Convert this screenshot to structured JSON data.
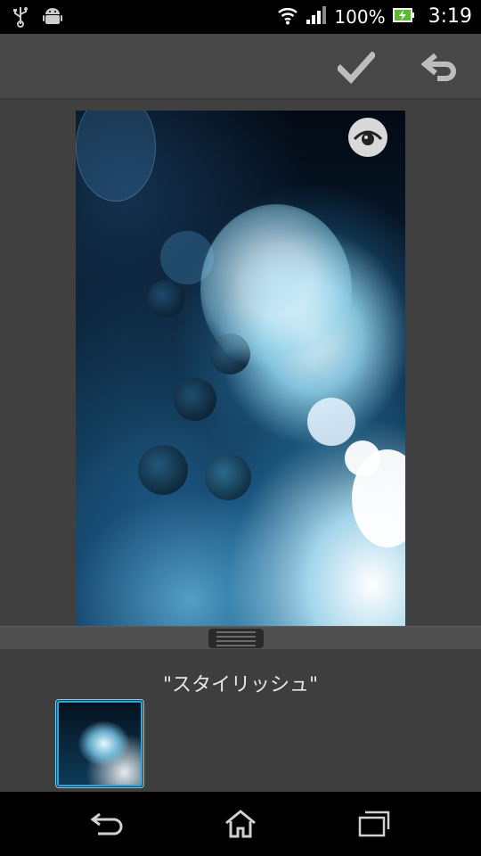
{
  "status_bar": {
    "battery_text": "100%",
    "time": "3:19",
    "icons": [
      "usb-icon",
      "android-debug-icon",
      "wifi-icon",
      "signal-icon",
      "battery-charging-icon"
    ]
  },
  "action_bar": {
    "icons": [
      "checkmark-icon",
      "undo-icon"
    ]
  },
  "editor": {
    "preview_icon": "eye-icon"
  },
  "filter_panel": {
    "current_filter": "\"スタイリッシュ\""
  },
  "nav_bar": {
    "icons": [
      "back-icon",
      "home-icon",
      "recent-apps-icon"
    ]
  },
  "colors": {
    "accent": "#2ea3d8",
    "status_bar_bg": "#000000",
    "action_bar_bg": "#474747",
    "panel_bg": "#3e3e3e"
  }
}
